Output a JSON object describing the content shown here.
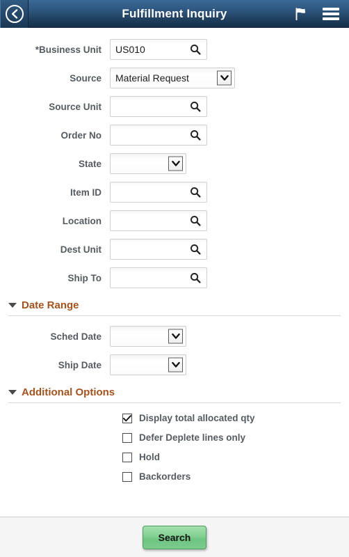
{
  "header": {
    "title": "Fulfillment Inquiry",
    "back_icon": "chevron-left-icon",
    "flag_icon": "flag-icon",
    "menu_icon": "hamburger-menu-icon"
  },
  "form": {
    "fields": [
      {
        "label": "*Business Unit",
        "required": true,
        "type": "lookup",
        "value": "US010",
        "placeholder": ""
      },
      {
        "label": "Source",
        "required": false,
        "type": "select",
        "value": "Material Request",
        "placeholder": ""
      },
      {
        "label": "Source Unit",
        "required": false,
        "type": "lookup",
        "value": "",
        "placeholder": ""
      },
      {
        "label": "Order No",
        "required": false,
        "type": "lookup",
        "value": "",
        "placeholder": ""
      },
      {
        "label": "State",
        "required": false,
        "type": "select-sm",
        "value": "",
        "placeholder": ""
      },
      {
        "label": "Item ID",
        "required": false,
        "type": "lookup",
        "value": "",
        "placeholder": ""
      },
      {
        "label": "Location",
        "required": false,
        "type": "lookup",
        "value": "",
        "placeholder": ""
      },
      {
        "label": "Dest Unit",
        "required": false,
        "type": "lookup",
        "value": "",
        "placeholder": ""
      },
      {
        "label": "Ship To",
        "required": false,
        "type": "lookup",
        "value": "",
        "placeholder": ""
      }
    ]
  },
  "date_range": {
    "title": "Date Range",
    "expanded": true,
    "fields": [
      {
        "label": "Sched Date",
        "type": "select-sm",
        "value": ""
      },
      {
        "label": "Ship Date",
        "type": "select-sm",
        "value": ""
      }
    ]
  },
  "additional_options": {
    "title": "Additional Options",
    "expanded": true,
    "checkboxes": [
      {
        "label": "Display total allocated qty",
        "checked": true
      },
      {
        "label": "Defer Deplete lines only",
        "checked": false
      },
      {
        "label": "Hold",
        "checked": false
      },
      {
        "label": "Backorders",
        "checked": false
      }
    ]
  },
  "footer": {
    "search_label": "Search"
  },
  "colors": {
    "header_top": "#3a6a96",
    "header_bottom": "#15304a",
    "section_title": "#a8521a",
    "label": "#555b60",
    "button_green": "#84d194",
    "footer_bg": "#f5f5f5"
  }
}
